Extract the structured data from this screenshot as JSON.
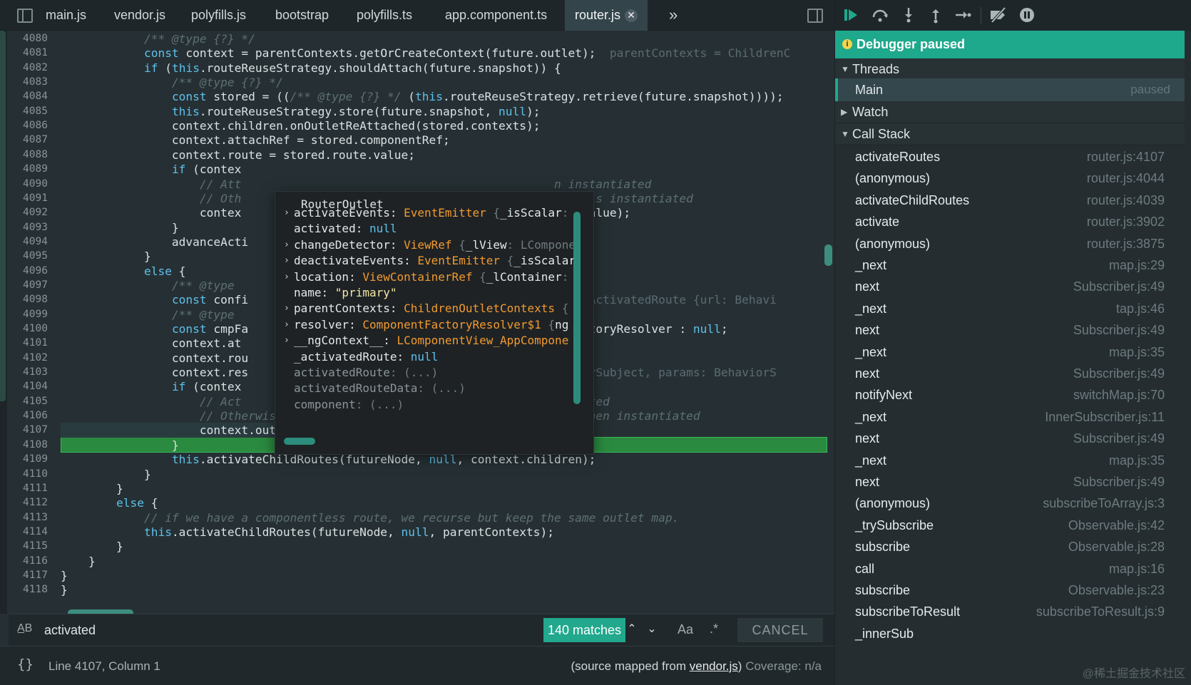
{
  "tabs": [
    {
      "label": "main.js",
      "active": false
    },
    {
      "label": "vendor.js",
      "active": false
    },
    {
      "label": "polyfills.js",
      "active": false
    },
    {
      "label": "bootstrap",
      "active": false
    },
    {
      "label": "polyfills.ts",
      "active": false
    },
    {
      "label": "app.component.ts",
      "active": false
    },
    {
      "label": "router.js",
      "active": true
    }
  ],
  "tab_close_glyph": "✕",
  "tab_more_glyph": "»",
  "code_lines": [
    {
      "n": "4080",
      "html": "            <span class='cm'>/** @type {?} */</span>"
    },
    {
      "n": "4081",
      "html": "            <span class='kw'>const</span> context = parentContexts.getOrCreateContext(future.outlet);  <span class='hint'>parentContexts = ChildrenC</span>"
    },
    {
      "n": "4082",
      "html": "            <span class='kw'>if</span> (<span class='kw'>this</span>.routeReuseStrategy.shouldAttach(future.snapshot)) {"
    },
    {
      "n": "4083",
      "html": "                <span class='cm'>/** @type {?} */</span>"
    },
    {
      "n": "4084",
      "html": "                <span class='kw'>const</span> stored = ((<span class='cm'>/** @type {?} */</span> (<span class='kw'>this</span>.routeReuseStrategy.retrieve(future.snapshot))));"
    },
    {
      "n": "4085",
      "html": "                <span class='kw'>this</span>.routeReuseStrategy.store(future.snapshot, <span class='nl'>null</span>);"
    },
    {
      "n": "4086",
      "html": "                context.children.onOutletReAttached(stored.contexts);"
    },
    {
      "n": "4087",
      "html": "                context.attachRef = stored.componentRef;"
    },
    {
      "n": "4088",
      "html": "                context.route = stored.route.value;"
    },
    {
      "n": "4089",
      "html": "                <span class='kw'>if</span> (contex"
    },
    {
      "n": "4090",
      "html": "                    <span class='cm'>// Att                                             n instantiated</span>"
    },
    {
      "n": "4091",
      "html": "                    <span class='cm'>// Oth                                             n it is instantiated</span>"
    },
    {
      "n": "4092",
      "html": "                    contex                                             ute.value);"
    },
    {
      "n": "4093",
      "html": "                }"
    },
    {
      "n": "4094",
      "html": "                advanceActi"
    },
    {
      "n": "4095",
      "html": "            }"
    },
    {
      "n": "4096",
      "html": "            <span class='kw'>else</span> {"
    },
    {
      "n": "4097",
      "html": "                <span class='cm'>/** @type </span>"
    },
    {
      "n": "4098",
      "html": "                <span class='kw'>const</span> confi                                           <span class='hint'>ure = ActivatedRoute {url: Behavi</span>"
    },
    {
      "n": "4099",
      "html": "                <span class='cm'>/** @type </span>"
    },
    {
      "n": "4100",
      "html": "                <span class='kw'>const</span> cmpFa                                           entFactoryResolver : <span class='nl'>null</span>;"
    },
    {
      "n": "4101",
      "html": "                context.at"
    },
    {
      "n": "4102",
      "html": "                context.rou"
    },
    {
      "n": "4103",
      "html": "                context.res                                           <span class='hint'>ehaviorSubject, params: BehaviorS</span>"
    },
    {
      "n": "4104",
      "html": "                <span class='kw'>if</span> (contex"
    },
    {
      "n": "4105",
      "html": "                    <span class='cm'>// Act                                             antiated</span>"
    },
    {
      "n": "4106",
      "html": "                    <span class='cm'>// Otherwise it will get activated from its `ngOnInit` when instantiated</span>"
    },
    {
      "n": "4107",
      "html": "                    context.outlet.activateWith(future, cmpFactoryResolver);",
      "current": true
    },
    {
      "n": "4108",
      "html": "                }"
    },
    {
      "n": "4109",
      "html": "                <span class='kw'>this</span>.activateChildRoutes(futureNode, <span class='nl'>null</span>, context.children);"
    },
    {
      "n": "4110",
      "html": "            }"
    },
    {
      "n": "4111",
      "html": "        }"
    },
    {
      "n": "4112",
      "html": "        <span class='kw'>else</span> {"
    },
    {
      "n": "4113",
      "html": "            <span class='cm'>// if we have a componentless route, we recurse but keep the same outlet map.</span>"
    },
    {
      "n": "4114",
      "html": "            <span class='kw'>this</span>.activateChildRoutes(futureNode, <span class='nl'>null</span>, parentContexts);"
    },
    {
      "n": "4115",
      "html": "        }"
    },
    {
      "n": "4116",
      "html": "    }"
    },
    {
      "n": "4117",
      "html": "}"
    },
    {
      "n": "4118",
      "html": "}"
    }
  ],
  "popover": {
    "title": "RouterOutlet",
    "props": [
      {
        "arrow": true,
        "key": "activateEvents",
        "html": ": <span class='pv-class'>EventEmitter</span> <span class='pv-gray'>{</span>_isScalar<span class='pv-gray'>:</span>"
      },
      {
        "arrow": false,
        "key": "activated",
        "html": ": <span class='pv-null'>null</span>"
      },
      {
        "arrow": true,
        "key": "changeDetector",
        "html": ": <span class='pv-class'>ViewRef</span> <span class='pv-gray'>{</span>_lView<span class='pv-gray'>: LCompone</span>"
      },
      {
        "arrow": true,
        "key": "deactivateEvents",
        "html": ": <span class='pv-class'>EventEmitter</span> <span class='pv-gray'>{</span>_isScalar"
      },
      {
        "arrow": true,
        "key": "location",
        "html": ": <span class='pv-class'>ViewContainerRef</span> <span class='pv-gray'>{</span>_lContainer<span class='pv-gray'>:</span>"
      },
      {
        "arrow": false,
        "key": "name",
        "html": ": <span class='pv-str'>\"primary\"</span>"
      },
      {
        "arrow": true,
        "key": "parentContexts",
        "html": ": <span class='pv-class'>ChildrenOutletContexts</span> <span class='pv-gray'>{</span>"
      },
      {
        "arrow": true,
        "key": "resolver",
        "html": ": <span class='pv-class'>ComponentFactoryResolver$1</span> <span class='pv-gray'>{</span>ng"
      },
      {
        "arrow": true,
        "key": "__ngContext__",
        "html": ": <span class='pv-class'>LComponentView_AppCompone</span>"
      },
      {
        "arrow": false,
        "key": "_activatedRoute",
        "html": ": <span class='pv-null'>null</span>"
      },
      {
        "arrow": false,
        "key": "activatedRoute",
        "dim": true,
        "html": "<span class='pv-gray'>: (...)</span>"
      },
      {
        "arrow": false,
        "key": "activatedRouteData",
        "dim": true,
        "html": "<span class='pv-gray'>: (...)</span>"
      },
      {
        "arrow": false,
        "key": "component",
        "dim": true,
        "html": "<span class='pv-gray'>: (...)</span>"
      }
    ]
  },
  "search": {
    "icon": "A̲B",
    "value": "activated",
    "matches": "140 matches",
    "prev_glyph": "⌃",
    "next_glyph": "⌄",
    "case_label": "Aa",
    "regex_label": ".*",
    "cancel_label": "CANCEL"
  },
  "status": {
    "braces": "{}",
    "cursor": "Line 4107, Column 1",
    "source_prefix": "(source mapped from ",
    "source_link": "vendor.js",
    "source_suffix": ")",
    "coverage": "Coverage: n/a"
  },
  "debugger": {
    "toolbar_icons": [
      "resume-icon",
      "step-over-icon",
      "step-into-icon",
      "step-out-icon",
      "step-icon",
      "deactivate-breakpoints-icon",
      "pause-on-exceptions-icon"
    ],
    "banner": "Debugger paused",
    "banner_icon": "i",
    "threads_label": "Threads",
    "thread_main": "Main",
    "thread_status": "paused",
    "watch_label": "Watch",
    "callstack_label": "Call Stack",
    "frames": [
      {
        "fn": "activateRoutes",
        "loc": "router.js:4107"
      },
      {
        "fn": "(anonymous)",
        "loc": "router.js:4044"
      },
      {
        "fn": "activateChildRoutes",
        "loc": "router.js:4039"
      },
      {
        "fn": "activate",
        "loc": "router.js:3902"
      },
      {
        "fn": "(anonymous)",
        "loc": "router.js:3875"
      },
      {
        "fn": "_next",
        "loc": "map.js:29"
      },
      {
        "fn": "next",
        "loc": "Subscriber.js:49"
      },
      {
        "fn": "_next",
        "loc": "tap.js:46"
      },
      {
        "fn": "next",
        "loc": "Subscriber.js:49"
      },
      {
        "fn": "_next",
        "loc": "map.js:35"
      },
      {
        "fn": "next",
        "loc": "Subscriber.js:49"
      },
      {
        "fn": "notifyNext",
        "loc": "switchMap.js:70"
      },
      {
        "fn": "_next",
        "loc": "InnerSubscriber.js:11"
      },
      {
        "fn": "next",
        "loc": "Subscriber.js:49"
      },
      {
        "fn": "_next",
        "loc": "map.js:35"
      },
      {
        "fn": "next",
        "loc": "Subscriber.js:49"
      },
      {
        "fn": "(anonymous)",
        "loc": "subscribeToArray.js:3"
      },
      {
        "fn": "_trySubscribe",
        "loc": "Observable.js:42"
      },
      {
        "fn": "subscribe",
        "loc": "Observable.js:28"
      },
      {
        "fn": "call",
        "loc": "map.js:16"
      },
      {
        "fn": "subscribe",
        "loc": "Observable.js:23"
      },
      {
        "fn": "subscribeToResult",
        "loc": "subscribeToResult.js:9"
      },
      {
        "fn": "_innerSub",
        "loc": ""
      }
    ],
    "watermark": "@稀土掘金技术社区"
  },
  "colors": {
    "accent": "#1ea88c",
    "exec_line": "#2a8a3f",
    "keyword": "#5ec0ea",
    "class_name": "#f29a2e"
  }
}
